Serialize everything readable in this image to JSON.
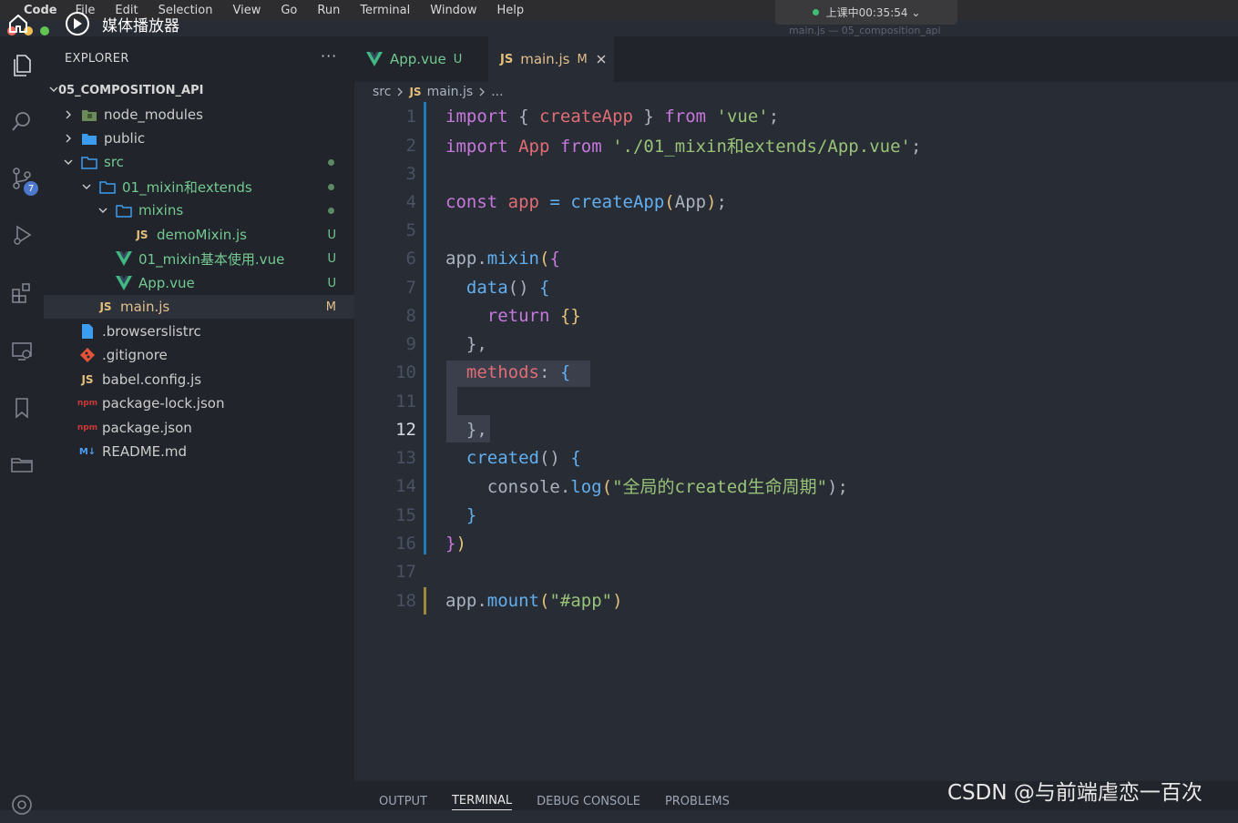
{
  "menubar": {
    "apple": "",
    "app": "Code",
    "items": [
      "File",
      "Edit",
      "Selection",
      "View",
      "Go",
      "Run",
      "Terminal",
      "Window",
      "Help"
    ]
  },
  "timer": "上课中00:35:54 ⌄",
  "window_title": "main.js — 05_composition_api",
  "media_player": {
    "title": "媒体播放器"
  },
  "activity_badge": "7",
  "explorer": {
    "header": "EXPLORER",
    "more": "···",
    "project": "05_COMPOSITION_API",
    "rows": [
      {
        "name": "node_modules",
        "badge": ""
      },
      {
        "name": "public",
        "badge": ""
      },
      {
        "name": "src",
        "badge": ""
      },
      {
        "name": "01_mixin和extends",
        "badge": ""
      },
      {
        "name": "mixins",
        "badge": ""
      },
      {
        "name": "demoMixin.js",
        "badge": "U"
      },
      {
        "name": "01_mixin基本使用.vue",
        "badge": "U"
      },
      {
        "name": "App.vue",
        "badge": "U"
      },
      {
        "name": "main.js",
        "badge": "M"
      },
      {
        "name": ".browserslistrc",
        "badge": ""
      },
      {
        "name": ".gitignore",
        "badge": ""
      },
      {
        "name": "babel.config.js",
        "badge": ""
      },
      {
        "name": "package-lock.json",
        "badge": ""
      },
      {
        "name": "package.json",
        "badge": ""
      },
      {
        "name": "README.md",
        "badge": ""
      }
    ],
    "icons": {
      "js": "JS",
      "npm": "npm",
      "md": "M↓"
    }
  },
  "tabs": [
    {
      "label": "App.vue",
      "badge": "U"
    },
    {
      "label": "main.js",
      "badge": "M"
    }
  ],
  "breadcrumb": {
    "folder": "src",
    "file": "main.js",
    "tail": "..."
  },
  "code": {
    "line_numbers": [
      "1",
      "2",
      "3",
      "4",
      "5",
      "6",
      "7",
      "8",
      "9",
      "10",
      "11",
      "12",
      "13",
      "14",
      "15",
      "16",
      "17",
      "18"
    ],
    "l1": [
      "import",
      "{",
      "createApp",
      "}",
      "from",
      "'vue'",
      ";"
    ],
    "l2": [
      "import",
      "App",
      "from",
      "'./01_mixin和extends/App.vue'",
      ";"
    ],
    "l4": [
      "const",
      "app",
      "=",
      "createApp",
      "(",
      "App",
      ")",
      ";"
    ],
    "l6": [
      "app",
      ".",
      "mixin",
      "(",
      "{"
    ],
    "l7": [
      "data",
      "()",
      "{"
    ],
    "l8": [
      "return",
      "{}"
    ],
    "l9": [
      "},"
    ],
    "l10": [
      "methods",
      ":",
      "{"
    ],
    "l12": [
      "},"
    ],
    "l13": [
      "created",
      "()",
      "{"
    ],
    "l14": [
      "console",
      ".",
      "log",
      "(",
      "\"全局的created生命周期\"",
      ");"
    ],
    "l15": [
      "}"
    ],
    "l16": [
      "}",
      ")"
    ],
    "l18": [
      "app",
      ".",
      "mount",
      "(",
      "\"#app\"",
      ")"
    ]
  },
  "panel_tabs": [
    "OUTPUT",
    "TERMINAL",
    "DEBUG CONSOLE",
    "PROBLEMS"
  ],
  "watermark": "CSDN @与前端虐恋一百次"
}
